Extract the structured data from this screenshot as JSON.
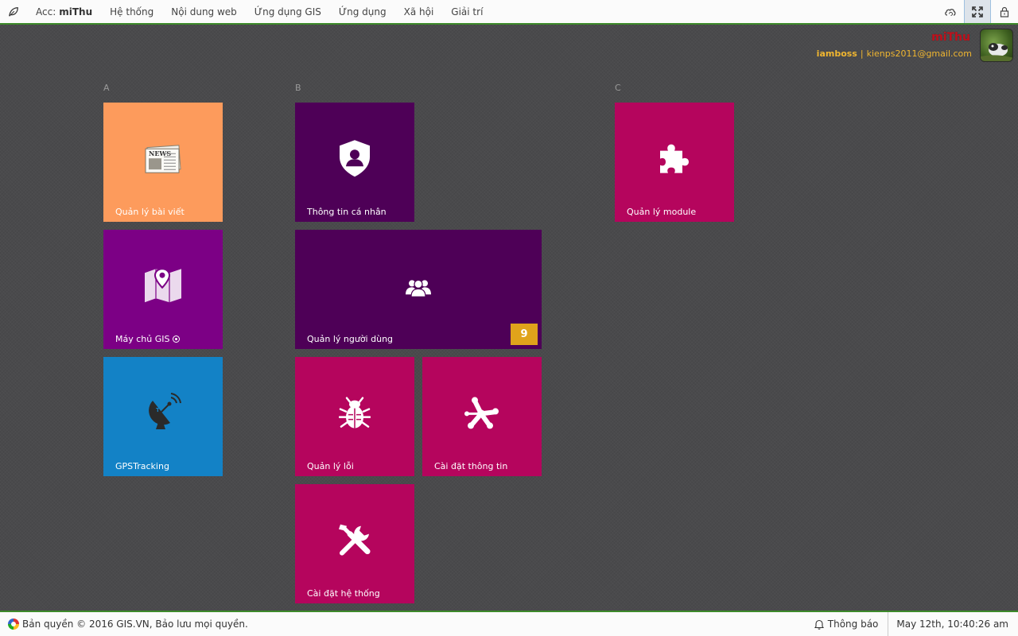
{
  "topbar": {
    "acc_label": "Acc:",
    "acc_name": "miThu",
    "menu": [
      "Hệ thống",
      "Nội dung web",
      "Ứng dụng GIS",
      "Ứng dụng",
      "Xã hội",
      "Giải trí"
    ]
  },
  "user": {
    "display_name": "miThu",
    "username": "iamboss",
    "separator": "|",
    "email": "kienps2011@gmail.com"
  },
  "groups": {
    "a": "A",
    "b": "B",
    "c": "C"
  },
  "tiles": {
    "posts": {
      "label": "Quản lý bài viết",
      "color": "#fd9b5c",
      "icon": "newspaper-icon"
    },
    "gis_server": {
      "label": "Máy chủ GIS",
      "color": "#7c0085",
      "icon": "map-pin-icon"
    },
    "gps": {
      "label": "GPSTracking",
      "color": "#1382c6",
      "icon": "satellite-dish-icon"
    },
    "profile": {
      "label": "Thông tin cá nhân",
      "color": "#4e0057",
      "icon": "shield-user-icon"
    },
    "users": {
      "label": "Quản lý người dùng",
      "color": "#4e0057",
      "icon": "users-icon",
      "badge": "9"
    },
    "bugs": {
      "label": "Quản lý lỗi",
      "color": "#b5055d",
      "icon": "bug-icon"
    },
    "info_settings": {
      "label": "Cài đặt thông tin",
      "color": "#b5055d",
      "icon": "network-icon"
    },
    "system_settings": {
      "label": "Cài đặt hệ thống",
      "color": "#b5055d",
      "icon": "tools-icon"
    },
    "modules": {
      "label": "Quản lý module",
      "color": "#b5055d",
      "icon": "puzzle-icon"
    }
  },
  "footer": {
    "copyright": "Bản quyền © 2016 GIS.VN, Bảo lưu mọi quyền.",
    "notifications": "Thông báo",
    "datetime": "May 12th, 10:40:26 am"
  }
}
